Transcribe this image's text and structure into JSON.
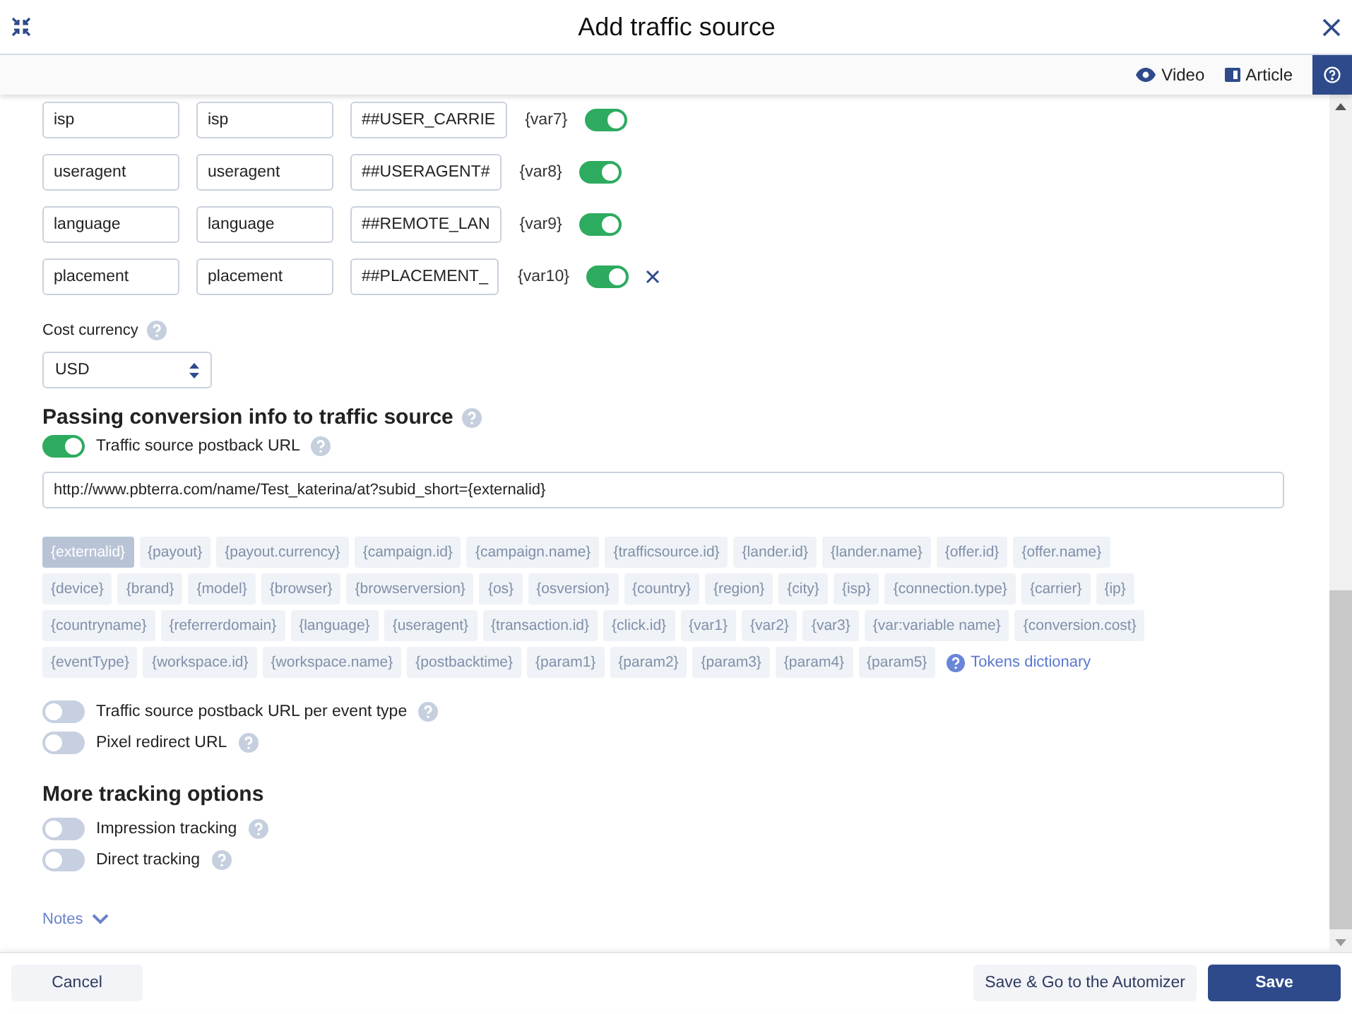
{
  "window": {
    "title": "Add traffic source"
  },
  "toolbar": {
    "links": [
      "Video",
      "Article"
    ]
  },
  "parameters": [
    {
      "name": "isp",
      "value": "isp",
      "token": "##USER_CARRIE",
      "variable": "{var7}",
      "on": true,
      "removable": false
    },
    {
      "name": "useragent",
      "value": "useragent",
      "token": "##USERAGENT#",
      "variable": "{var8}",
      "on": true,
      "removable": false
    },
    {
      "name": "language",
      "value": "language",
      "token": "##REMOTE_LAN",
      "variable": "{var9}",
      "on": true,
      "removable": false
    },
    {
      "name": "placement",
      "value": "placement",
      "token": "##PLACEMENT_",
      "variable": "{var10}",
      "on": true,
      "removable": true
    }
  ],
  "cost_currency": {
    "label": "Cost currency",
    "value": "USD"
  },
  "conversion": {
    "heading": "Passing conversion info to traffic source",
    "postback": {
      "label": "Traffic source postback URL",
      "on": true,
      "value": "http://www.pbterra.com/name/Test_katerina/at?subid_short={externalid}"
    },
    "tokens": [
      [
        {
          "label": "{externalid}",
          "selected": true
        },
        {
          "label": "{payout}",
          "selected": false
        },
        {
          "label": "{payout.currency}",
          "selected": false
        },
        {
          "label": "{campaign.id}",
          "selected": false
        },
        {
          "label": "{campaign.name}",
          "selected": false
        },
        {
          "label": "{trafficsource.id}",
          "selected": false
        },
        {
          "label": "{lander.id}",
          "selected": false
        },
        {
          "label": "{lander.name}",
          "selected": false
        },
        {
          "label": "{offer.id}",
          "selected": false
        },
        {
          "label": "{offer.name}",
          "selected": false
        }
      ],
      [
        {
          "label": "{device}",
          "selected": false
        },
        {
          "label": "{brand}",
          "selected": false
        },
        {
          "label": "{model}",
          "selected": false
        },
        {
          "label": "{browser}",
          "selected": false
        },
        {
          "label": "{browserversion}",
          "selected": false
        },
        {
          "label": "{os}",
          "selected": false
        },
        {
          "label": "{osversion}",
          "selected": false
        },
        {
          "label": "{country}",
          "selected": false
        },
        {
          "label": "{region}",
          "selected": false
        },
        {
          "label": "{city}",
          "selected": false
        },
        {
          "label": "{isp}",
          "selected": false
        },
        {
          "label": "{connection.type}",
          "selected": false
        },
        {
          "label": "{carrier}",
          "selected": false
        },
        {
          "label": "{ip}",
          "selected": false
        }
      ],
      [
        {
          "label": "{countryname}",
          "selected": false
        },
        {
          "label": "{referrerdomain}",
          "selected": false
        },
        {
          "label": "{language}",
          "selected": false
        },
        {
          "label": "{useragent}",
          "selected": false
        },
        {
          "label": "{transaction.id}",
          "selected": false
        },
        {
          "label": "{click.id}",
          "selected": false
        },
        {
          "label": "{var1}",
          "selected": false
        },
        {
          "label": "{var2}",
          "selected": false
        },
        {
          "label": "{var3}",
          "selected": false
        },
        {
          "label": "{var:variable name}",
          "selected": false
        },
        {
          "label": "{conversion.cost}",
          "selected": false
        }
      ],
      [
        {
          "label": "{eventType}",
          "selected": false
        },
        {
          "label": "{workspace.id}",
          "selected": false
        },
        {
          "label": "{workspace.name}",
          "selected": false
        },
        {
          "label": "{postbacktime}",
          "selected": false
        },
        {
          "label": "{param1}",
          "selected": false
        },
        {
          "label": "{param2}",
          "selected": false
        },
        {
          "label": "{param3}",
          "selected": false
        },
        {
          "label": "{param4}",
          "selected": false
        },
        {
          "label": "{param5}",
          "selected": false
        }
      ]
    ],
    "tokens_link": "Tokens dictionary",
    "switches": [
      {
        "label": "Traffic source postback URL per event type",
        "on": false
      },
      {
        "label": "Pixel redirect URL",
        "on": false
      }
    ]
  },
  "more_tracking": {
    "heading": "More tracking options",
    "switches": [
      {
        "label": "Impression tracking",
        "on": false
      },
      {
        "label": "Direct tracking",
        "on": false
      }
    ]
  },
  "notes": "Notes",
  "footer": {
    "cancel": "Cancel",
    "secondary": "Save & Go to the Automizer",
    "primary": "Save"
  }
}
